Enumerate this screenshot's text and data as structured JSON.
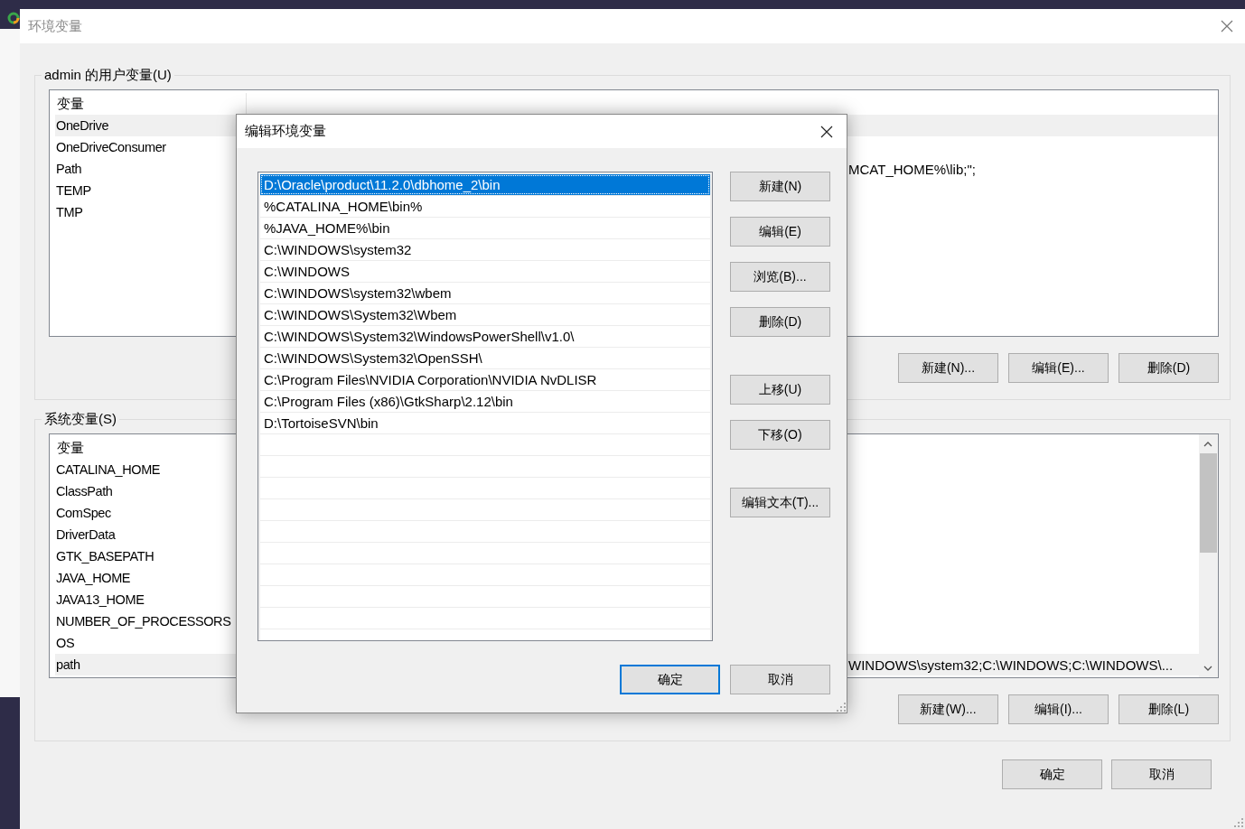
{
  "window": {
    "title": "环境变量"
  },
  "user_variables": {
    "label": "admin 的用户变量(U)",
    "columns": [
      "变量"
    ],
    "rows": [
      {
        "name": "OneDrive",
        "selected": true
      },
      {
        "name": "OneDriveConsumer",
        "selected": false
      },
      {
        "name": "Path",
        "value": "MCAT_HOME%\\lib;\";",
        "selected": false
      },
      {
        "name": "TEMP",
        "selected": false
      },
      {
        "name": "TMP",
        "selected": false
      }
    ],
    "buttons": [
      "新建(N)...",
      "编辑(E)...",
      "删除(D)"
    ]
  },
  "system_variables": {
    "label": "系统变量(S)",
    "columns": [
      "变量"
    ],
    "rows": [
      {
        "name": "CATALINA_HOME",
        "selected": false
      },
      {
        "name": "ClassPath",
        "selected": false
      },
      {
        "name": "ComSpec",
        "selected": false
      },
      {
        "name": "DriverData",
        "selected": false
      },
      {
        "name": "GTK_BASEPATH",
        "selected": false
      },
      {
        "name": "JAVA_HOME",
        "selected": false
      },
      {
        "name": "JAVA13_HOME",
        "selected": false
      },
      {
        "name": "NUMBER_OF_PROCESSORS",
        "selected": false
      },
      {
        "name": "OS",
        "selected": false
      },
      {
        "name": "path",
        "value": "WINDOWS\\system32;C:\\WINDOWS;C:\\WINDOWS\\...",
        "selected": true
      }
    ],
    "buttons": [
      "新建(W)...",
      "编辑(I)...",
      "删除(L)"
    ]
  },
  "footer_buttons": [
    {
      "label": "确定",
      "default": false
    },
    {
      "label": "取消",
      "default": false
    }
  ],
  "edit_dialog": {
    "title": "编辑环境变量",
    "entries": [
      {
        "text": "D:\\Oracle\\product\\11.2.0\\dbhome_2\\bin",
        "selected": true
      },
      {
        "text": "%CATALINA_HOME\\bin%",
        "selected": false
      },
      {
        "text": "%JAVA_HOME%\\bin",
        "selected": false
      },
      {
        "text": "C:\\WINDOWS\\system32",
        "selected": false
      },
      {
        "text": "C:\\WINDOWS",
        "selected": false
      },
      {
        "text": "C:\\WINDOWS\\system32\\wbem",
        "selected": false
      },
      {
        "text": "C:\\WINDOWS\\System32\\Wbem",
        "selected": false
      },
      {
        "text": "C:\\WINDOWS\\System32\\WindowsPowerShell\\v1.0\\",
        "selected": false
      },
      {
        "text": "C:\\WINDOWS\\System32\\OpenSSH\\",
        "selected": false
      },
      {
        "text": "C:\\Program Files\\NVIDIA Corporation\\NVIDIA NvDLISR",
        "selected": false
      },
      {
        "text": "C:\\Program Files (x86)\\GtkSharp\\2.12\\bin",
        "selected": false
      },
      {
        "text": "D:\\TortoiseSVN\\bin",
        "selected": false
      }
    ],
    "button_groups": [
      [
        "新建(N)",
        "编辑(E)",
        "浏览(B)...",
        "删除(D)"
      ],
      [
        "上移(U)",
        "下移(O)"
      ],
      [
        "编辑文本(T)..."
      ]
    ],
    "footer_buttons": [
      {
        "label": "确定",
        "default": true
      },
      {
        "label": "取消",
        "default": false
      }
    ]
  }
}
